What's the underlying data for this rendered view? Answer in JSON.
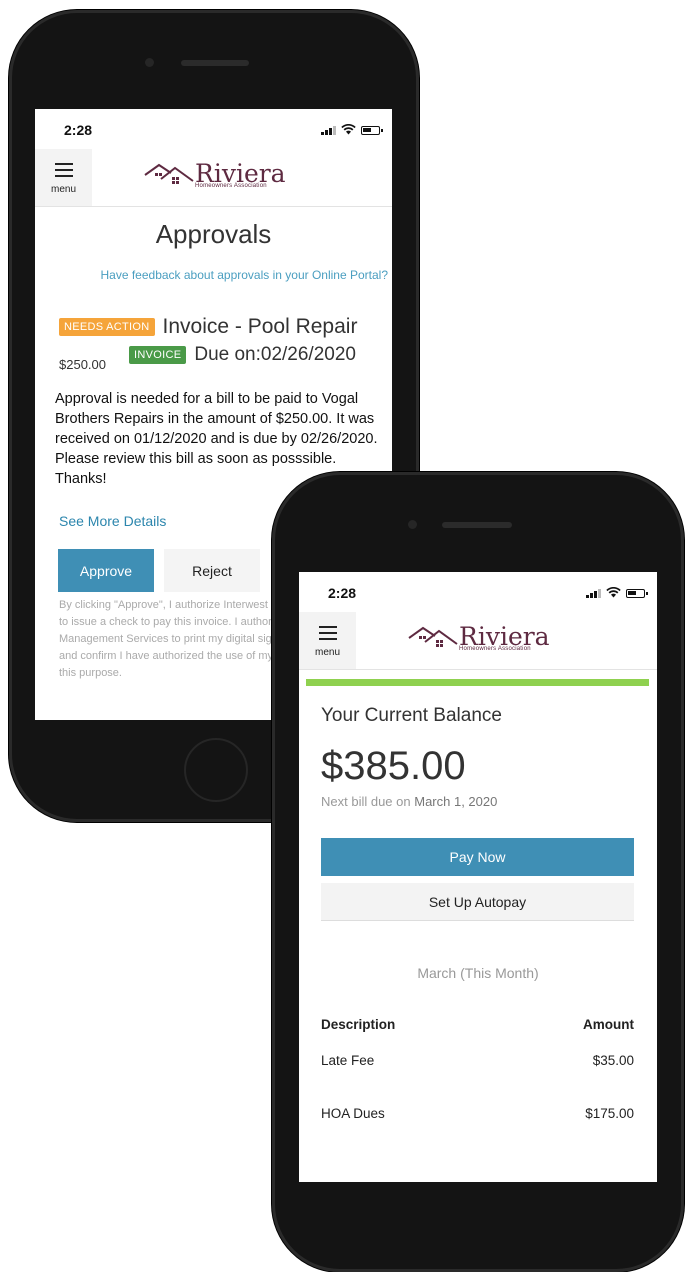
{
  "status": {
    "time": "2:28"
  },
  "header": {
    "menu_label": "menu",
    "brand_name": "Riviera",
    "brand_sub": "Homeowners Association"
  },
  "approvals": {
    "title": "Approvals",
    "feedback_link": "Have feedback about approvals in your Online Portal?",
    "item": {
      "status_badge": "NEEDS ACTION",
      "title": "Invoice - Pool Repair",
      "amount": "$250.00",
      "type_badge": "INVOICE",
      "due_label": "Due on:",
      "due_date": "02/26/2020",
      "description": "Approval is needed for a bill to be paid to Vogal Brothers Repairs in the amount of $250.00. It was received on 01/12/2020 and is due by 02/26/2020. Please review this bill as soon as posssible. Thanks!",
      "see_more": "See More Details",
      "approve_label": "Approve",
      "reject_label": "Reject",
      "disclaimer": "By clicking \"Approve\", I authorize Interwest Management Services to issue a check to pay this invoice. I authorize Interwest Management Services to print my digital signature on this check and confirm I have authorized the use of my digital signature for this purpose."
    }
  },
  "balance": {
    "title": "Your Current Balance",
    "amount": "$385.00",
    "next_bill_prefix": "Next bill due on",
    "next_bill_date": "March 1, 2020",
    "pay_now_label": "Pay Now",
    "autopay_label": "Set Up Autopay",
    "period": "March (This Month)",
    "columns": {
      "description": "Description",
      "amount": "Amount"
    },
    "rows": [
      {
        "description": "Late Fee",
        "amount": "$35.00"
      },
      {
        "description": "HOA Dues",
        "amount": "$175.00"
      }
    ]
  },
  "colors": {
    "accent_blue": "#3f8fb5",
    "brand": "#5e2a41",
    "needs_action": "#f5a43a",
    "invoice": "#4a9a48",
    "progress": "#8fd14f"
  }
}
